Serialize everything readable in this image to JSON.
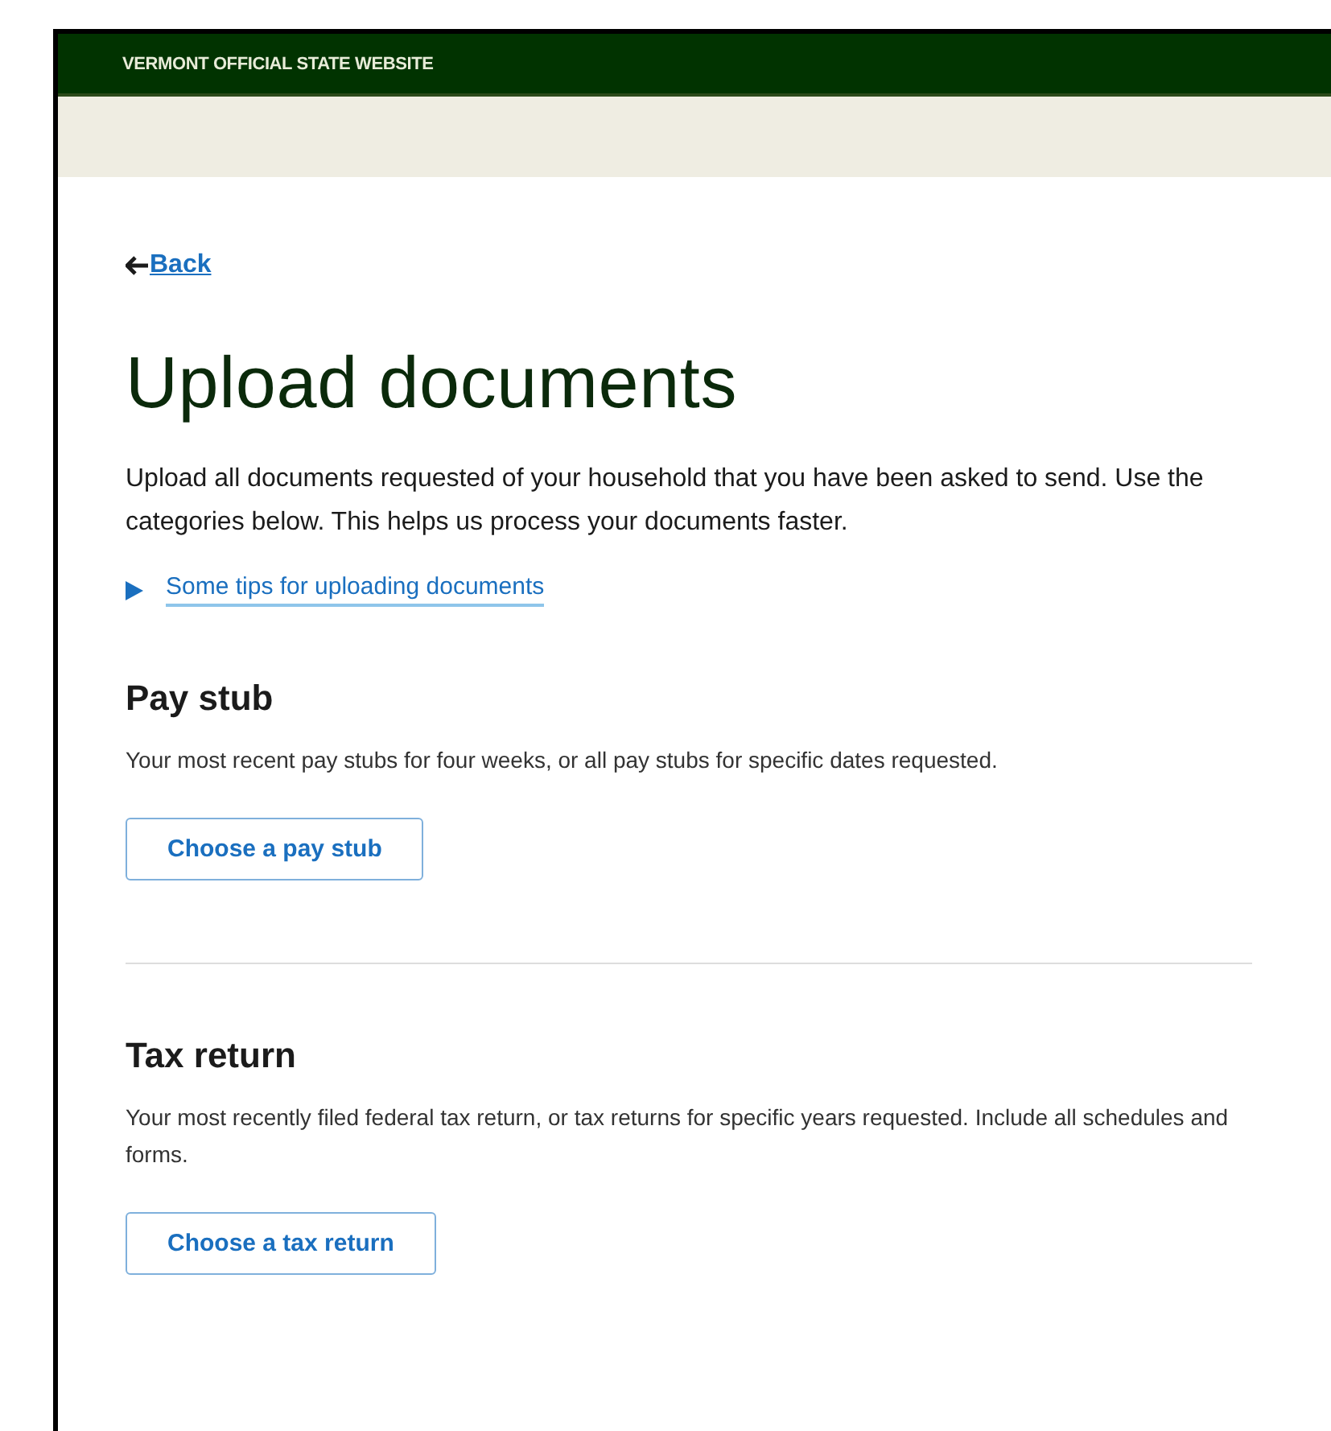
{
  "banner": {
    "title": "VERMONT OFFICIAL STATE WEBSITE"
  },
  "back_link": {
    "label": "Back"
  },
  "heading": "Upload documents",
  "intro": "Upload all documents requested of your household that you have been asked to send. Use the categories below. This helps us process your documents faster.",
  "tips": {
    "label": "Some tips for uploading documents",
    "expanded": false
  },
  "sections": [
    {
      "title": "Pay stub",
      "description": "Your most recent pay stubs for four weeks, or all pay stubs for specific dates requested.",
      "button": "Choose a pay stub"
    },
    {
      "title": "Tax return",
      "description": "Your most recently filed federal tax return, or tax returns for specific years requested. Include all schedules and forms.",
      "button": "Choose a tax return"
    }
  ]
}
